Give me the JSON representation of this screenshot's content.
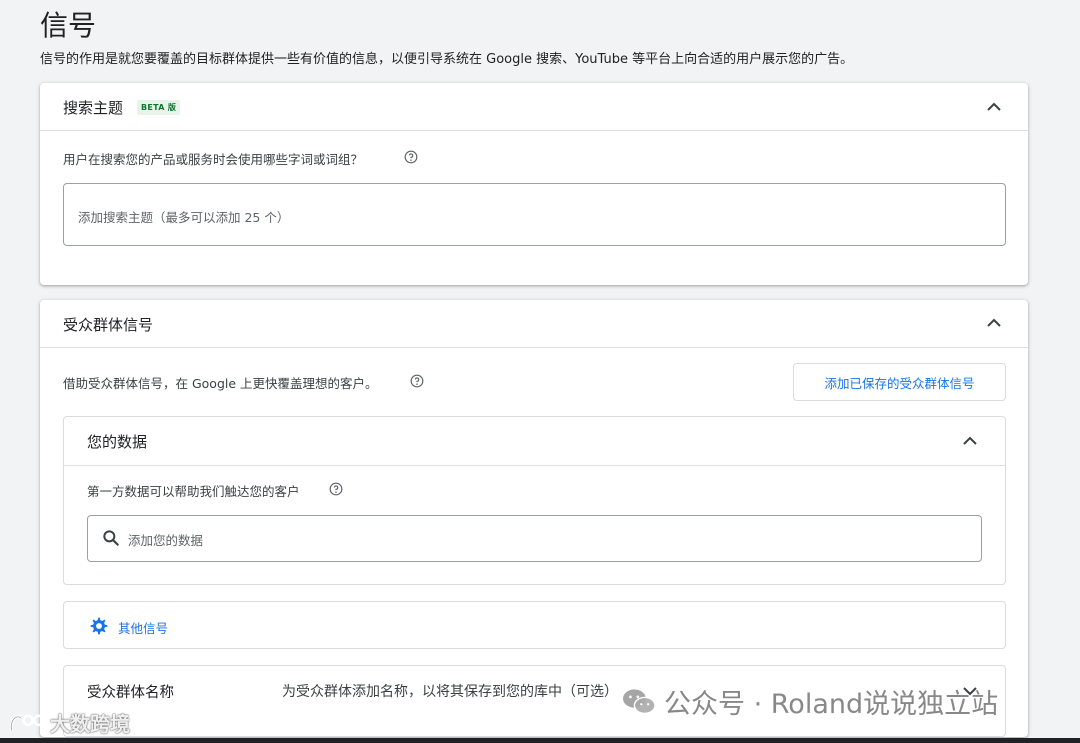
{
  "page": {
    "title": "信号",
    "description": "信号的作用是就您要覆盖的目标群体提供一些有价值的信息，以便引导系统在 Google 搜索、YouTube 等平台上向合适的用户展示您的广告。"
  },
  "search_topics": {
    "title": "搜索主题",
    "badge": "BETA 版",
    "question": "用户在搜索您的产品或服务时会使用哪些字词或词组？",
    "input_placeholder": "添加搜索主题（最多可以添加 25 个）"
  },
  "audience_signals": {
    "title": "受众群体信号",
    "description": "借助受众群体信号，在 Google 上更快覆盖理想的客户。",
    "add_saved_button": "添加已保存的受众群体信号",
    "your_data": {
      "title": "您的数据",
      "description": "第一方数据可以帮助我们触达您的客户",
      "search_placeholder": "添加您的数据"
    },
    "other_signals": {
      "label": "其他信号"
    },
    "audience_name": {
      "label": "受众群体名称",
      "hint": "为受众群体添加名称，以将其保存到您的库中（可选）"
    }
  },
  "watermarks": {
    "left": "大数跨境",
    "right": "公众号 · Roland说说独立站"
  },
  "icons": {
    "collapse": "chevron-up-icon",
    "expand": "chevron-down-icon",
    "help": "help-circle-icon",
    "search": "search-icon",
    "settings": "gear-icon"
  },
  "colors": {
    "accent": "#1a73e8",
    "badge_text": "#137333",
    "badge_bg": "#e6f4ea"
  }
}
